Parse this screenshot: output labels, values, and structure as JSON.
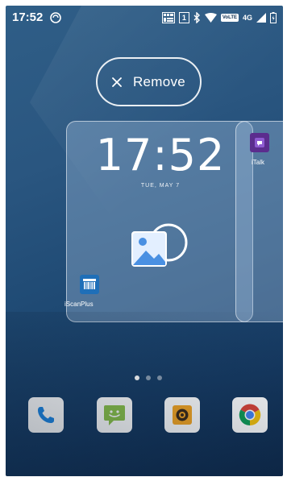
{
  "status_bar": {
    "time": "17:52",
    "network_label": "4G",
    "volte_label": "VoLTE",
    "sim_label": "1",
    "icons": [
      "sync-icon",
      "sim-card-icon",
      "sim-slot-icon",
      "bluetooth-icon",
      "wifi-icon",
      "volte-icon",
      "signal-icon",
      "battery-icon"
    ]
  },
  "remove_zone": {
    "label": "Remove",
    "icon": "close-icon"
  },
  "workspace": {
    "main_page": {
      "clock_widget": {
        "time": "17:52",
        "date": "TUE, MAY 7"
      },
      "widget_preview_icon": "image-widget-icon",
      "apps": [
        {
          "label": "iScanPlus",
          "icon": "barcode-scanner-icon",
          "color": "#1f6fb8"
        }
      ]
    },
    "next_page": {
      "apps": [
        {
          "label": "iTalk",
          "icon": "italk-icon",
          "color": "#5b2d8e"
        }
      ]
    },
    "page_count": 3,
    "active_page": 1
  },
  "dock": {
    "apps": [
      {
        "name": "Phone",
        "icon": "phone-icon",
        "color": "#1e88e5"
      },
      {
        "name": "Messages",
        "icon": "messages-icon",
        "color": "#8bc34a"
      },
      {
        "name": "Camera",
        "icon": "camera-icon",
        "color": "#f5a623"
      },
      {
        "name": "Chrome",
        "icon": "chrome-icon",
        "color": "#db4437"
      }
    ]
  },
  "colors": {
    "wallpaper_top": "#2f5e87",
    "wallpaper_bottom": "#0f2b4d",
    "card_fill": "#a0bedc",
    "accent_white": "#ffffff"
  }
}
